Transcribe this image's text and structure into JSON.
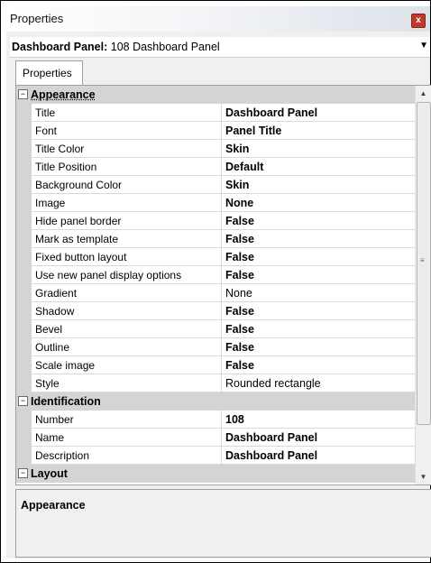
{
  "window": {
    "title": "Properties",
    "close_label": "x"
  },
  "selector": {
    "bold": "Dashboard Panel:",
    "rest": " 108 Dashboard Panel",
    "arrow": "▼"
  },
  "tabs": [
    {
      "label": "Properties"
    }
  ],
  "categories": [
    {
      "name": "Appearance",
      "expanded": true,
      "props": [
        {
          "name": "Title",
          "value": "Dashboard Panel",
          "bold": true
        },
        {
          "name": "Font",
          "value": "Panel Title",
          "bold": true
        },
        {
          "name": "Title Color",
          "value": "Skin",
          "bold": true
        },
        {
          "name": "Title Position",
          "value": "Default",
          "bold": true
        },
        {
          "name": "Background Color",
          "value": "Skin",
          "bold": true
        },
        {
          "name": "Image",
          "value": "None",
          "bold": true
        },
        {
          "name": "Hide panel border",
          "value": "False",
          "bold": true
        },
        {
          "name": "Mark as template",
          "value": "False",
          "bold": true
        },
        {
          "name": "Fixed button layout",
          "value": "False",
          "bold": true
        },
        {
          "name": "Use new panel display options",
          "value": "False",
          "bold": true
        },
        {
          "name": "Gradient",
          "value": "None",
          "bold": false
        },
        {
          "name": "Shadow",
          "value": "False",
          "bold": true
        },
        {
          "name": "Bevel",
          "value": "False",
          "bold": true
        },
        {
          "name": "Outline",
          "value": "False",
          "bold": true
        },
        {
          "name": "Scale image",
          "value": "False",
          "bold": true
        },
        {
          "name": "Style",
          "value": "Rounded rectangle",
          "bold": false
        }
      ]
    },
    {
      "name": "Identification",
      "expanded": true,
      "props": [
        {
          "name": "Number",
          "value": "108",
          "bold": true
        },
        {
          "name": "Name",
          "value": "Dashboard Panel",
          "bold": true
        },
        {
          "name": "Description",
          "value": "Dashboard Panel",
          "bold": true
        }
      ]
    },
    {
      "name": "Layout",
      "expanded": true,
      "props": []
    }
  ],
  "expander_symbol": "⊟",
  "description": {
    "title": "Appearance"
  }
}
